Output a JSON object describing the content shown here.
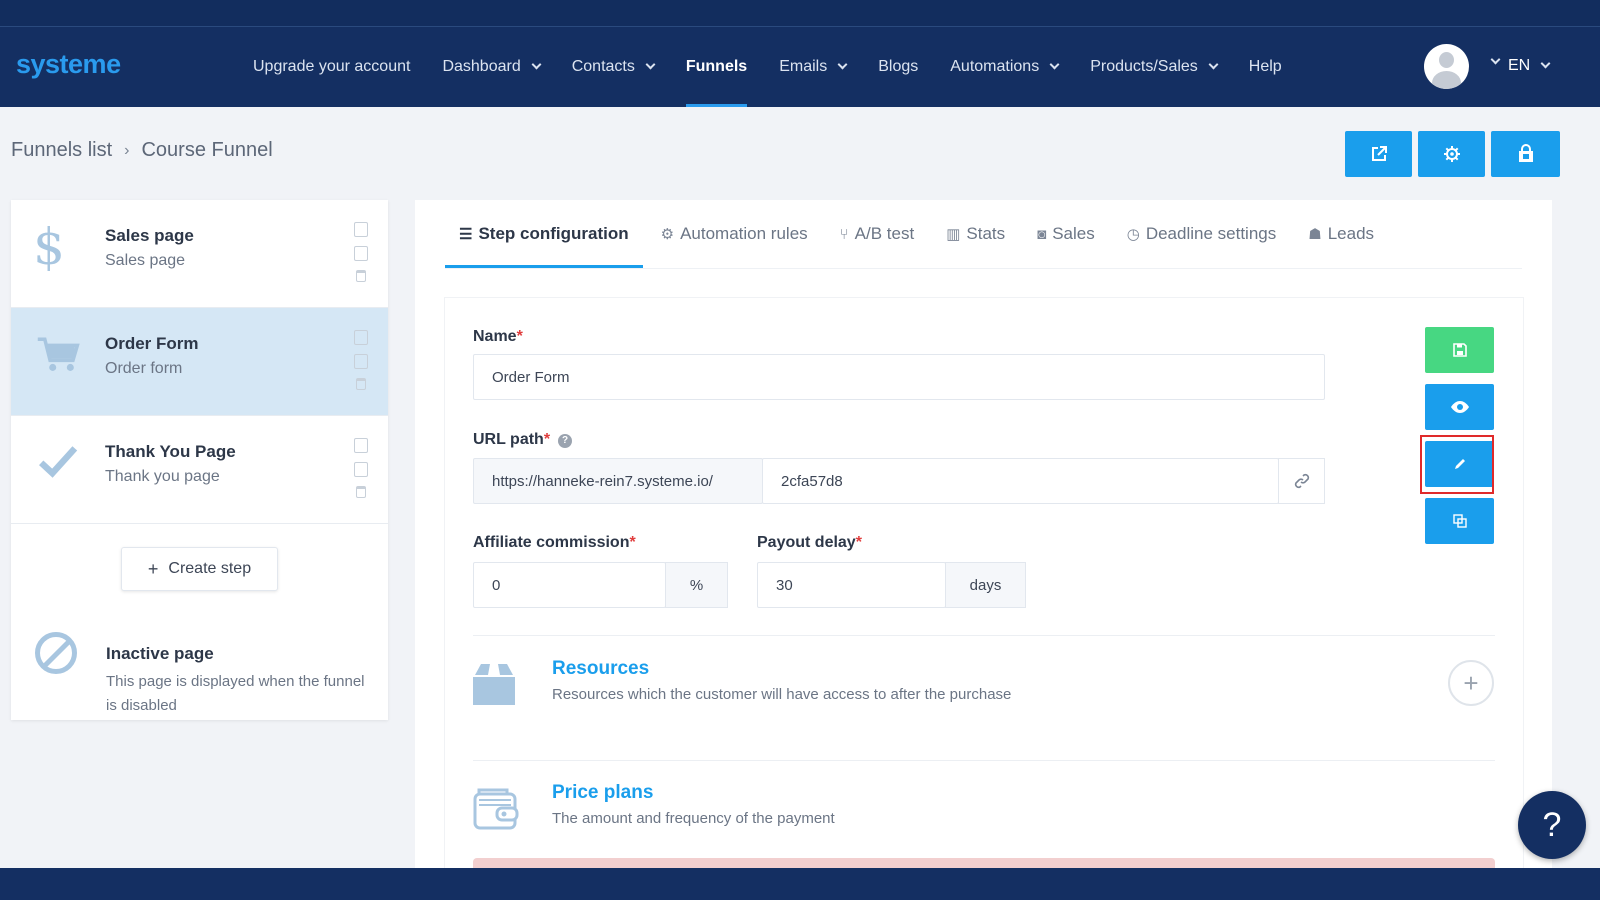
{
  "app": {
    "logo": "systeme"
  },
  "nav": {
    "items": [
      {
        "label": "Upgrade your account",
        "dropdown": false,
        "active": false
      },
      {
        "label": "Dashboard",
        "dropdown": true,
        "active": false
      },
      {
        "label": "Contacts",
        "dropdown": true,
        "active": false
      },
      {
        "label": "Funnels",
        "dropdown": false,
        "active": true
      },
      {
        "label": "Emails",
        "dropdown": true,
        "active": false
      },
      {
        "label": "Blogs",
        "dropdown": false,
        "active": false
      },
      {
        "label": "Automations",
        "dropdown": true,
        "active": false
      },
      {
        "label": "Products/Sales",
        "dropdown": true,
        "active": false
      },
      {
        "label": "Help",
        "dropdown": false,
        "active": false
      }
    ],
    "language": "EN"
  },
  "breadcrumb": {
    "parent": "Funnels list",
    "separator": "›",
    "current": "Course Funnel"
  },
  "top_actions": {
    "icons": [
      "external-link-icon",
      "gear-icon",
      "store-icon"
    ]
  },
  "steps": [
    {
      "title": "Sales page",
      "subtitle": "Sales page",
      "icon": "dollar-icon",
      "selected": false
    },
    {
      "title": "Order Form",
      "subtitle": "Order form",
      "icon": "cart-icon",
      "selected": true
    },
    {
      "title": "Thank You Page",
      "subtitle": "Thank you page",
      "icon": "check-icon",
      "selected": false
    }
  ],
  "create_step": {
    "label": "Create step",
    "plus": "+"
  },
  "inactive_page": {
    "title": "Inactive page",
    "description": "This page is displayed when the funnel is disabled"
  },
  "tabs": [
    {
      "label": "Step configuration",
      "icon": "list-icon",
      "glyph": "☰",
      "active": true
    },
    {
      "label": "Automation rules",
      "icon": "cogs-icon",
      "glyph": "⚙",
      "active": false
    },
    {
      "label": "A/B test",
      "icon": "split-icon",
      "glyph": "⑂",
      "active": false
    },
    {
      "label": "Stats",
      "icon": "bar-chart-icon",
      "glyph": "▥",
      "active": false
    },
    {
      "label": "Sales",
      "icon": "money-icon",
      "glyph": "◙",
      "active": false
    },
    {
      "label": "Deadline settings",
      "icon": "clock-icon",
      "glyph": "◷",
      "active": false
    },
    {
      "label": "Leads",
      "icon": "users-icon",
      "glyph": "☗",
      "active": false
    }
  ],
  "form": {
    "name": {
      "label": "Name",
      "required": "*",
      "value": "Order Form"
    },
    "url_path": {
      "label": "URL path",
      "required": "*",
      "help": "?",
      "prefix": "https://hanneke-rein7.systeme.io/",
      "value": "2cfa57d8"
    },
    "affiliate_commission": {
      "label": "Affiliate commission",
      "required": "*",
      "value": "0",
      "unit": "%"
    },
    "payout_delay": {
      "label": "Payout delay",
      "required": "*",
      "value": "30",
      "unit": "days"
    }
  },
  "side_actions": {
    "icons": [
      "save-icon",
      "eye-icon",
      "pencil-icon",
      "copy-icon"
    ]
  },
  "sections": {
    "resources": {
      "title": "Resources",
      "description": "Resources which the customer will have access to after the purchase",
      "add": "+"
    },
    "price_plans": {
      "title": "Price plans",
      "description": "The amount and frequency of the payment"
    }
  },
  "help_fab": "?",
  "colors": {
    "navy": "#142f62",
    "accent": "#1a9eec",
    "green": "#47d782",
    "highlight": "#e02a2a"
  }
}
